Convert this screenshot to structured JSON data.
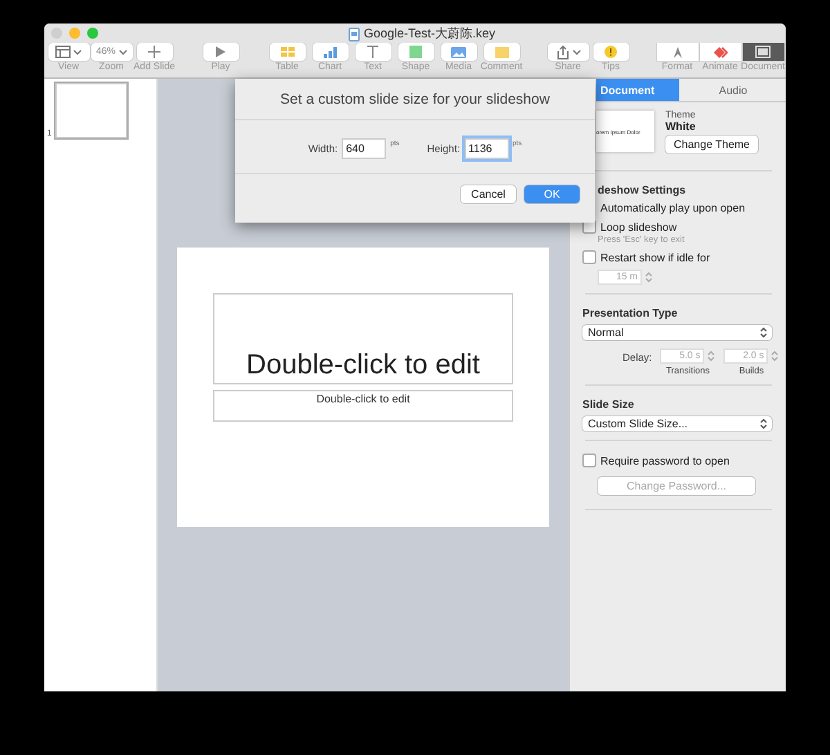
{
  "window": {
    "title": "Google-Test-大蔚陈.key",
    "buttons": [
      {
        "kind": "close",
        "disabled": true
      },
      {
        "kind": "minimize",
        "disabled": false
      },
      {
        "kind": "zoom",
        "disabled": false
      }
    ]
  },
  "toolbar": {
    "groups": [
      [
        {
          "kind": "view",
          "label": "View"
        },
        {
          "kind": "zoom",
          "label": "Zoom",
          "value": "46%"
        },
        {
          "kind": "add",
          "label": "Add Slide"
        }
      ],
      [
        {
          "kind": "play",
          "label": "Play"
        }
      ],
      [
        {
          "kind": "table",
          "label": "Table"
        },
        {
          "kind": "chart",
          "label": "Chart"
        },
        {
          "kind": "text",
          "label": "Text"
        },
        {
          "kind": "shape",
          "label": "Shape"
        },
        {
          "kind": "media",
          "label": "Media"
        },
        {
          "kind": "comment",
          "label": "Comment"
        }
      ],
      [
        {
          "kind": "share",
          "label": "Share"
        },
        {
          "kind": "tips",
          "label": "Tips"
        }
      ],
      [
        {
          "kind": "format",
          "label": "Format",
          "selected": false
        },
        {
          "kind": "animate",
          "label": "Animate",
          "selected": false
        },
        {
          "kind": "document",
          "label": "Document",
          "selected": true
        }
      ]
    ]
  },
  "navigator": {
    "slides": [
      {
        "number": "1",
        "selected": true
      }
    ]
  },
  "slide": {
    "title": "Double-click to edit",
    "subtitle": "Double-click to edit"
  },
  "dialog": {
    "title": "Set a custom slide size for your slideshow",
    "fields": [
      {
        "label": "Width:",
        "value": "640",
        "unit": "pts",
        "focused": false
      },
      {
        "label": "Height:",
        "value": "1136",
        "unit": "pts",
        "focused": true
      }
    ],
    "buttons": [
      {
        "label": "Cancel",
        "default": false
      },
      {
        "label": "OK",
        "default": true
      }
    ]
  },
  "inspector": {
    "tabs": [
      {
        "label": "Document",
        "selected": true
      },
      {
        "label": "Audio",
        "selected": false
      }
    ],
    "theme": {
      "thumbnail_text": "orem Ipsum Dolor",
      "label": "Theme",
      "name": "White",
      "button": "Change Theme"
    },
    "slideshow": {
      "heading": "deshow Settings",
      "options": [
        {
          "kind": "hidden-check",
          "label": "Automatically play upon open"
        },
        {
          "kind": "checkbox",
          "label": "Loop slideshow",
          "checked": false,
          "hint": "Press 'Esc' key to exit"
        },
        {
          "kind": "checkbox",
          "label": "Restart show if idle for",
          "checked": false
        }
      ],
      "idle": {
        "value": "15 m",
        "disabled": true
      }
    },
    "presentation": {
      "heading": "Presentation Type",
      "value": "Normal",
      "delay_label": "Delay:",
      "delays": [
        {
          "value": "5.0 s",
          "caption": "Transitions",
          "disabled": true
        },
        {
          "value": "2.0 s",
          "caption": "Builds",
          "disabled": true
        }
      ]
    },
    "slide_size": {
      "heading": "Slide Size",
      "value": "Custom Slide Size..."
    },
    "password": {
      "label": "Require password to open",
      "checked": false,
      "button": "Change Password...",
      "button_disabled": true
    }
  }
}
